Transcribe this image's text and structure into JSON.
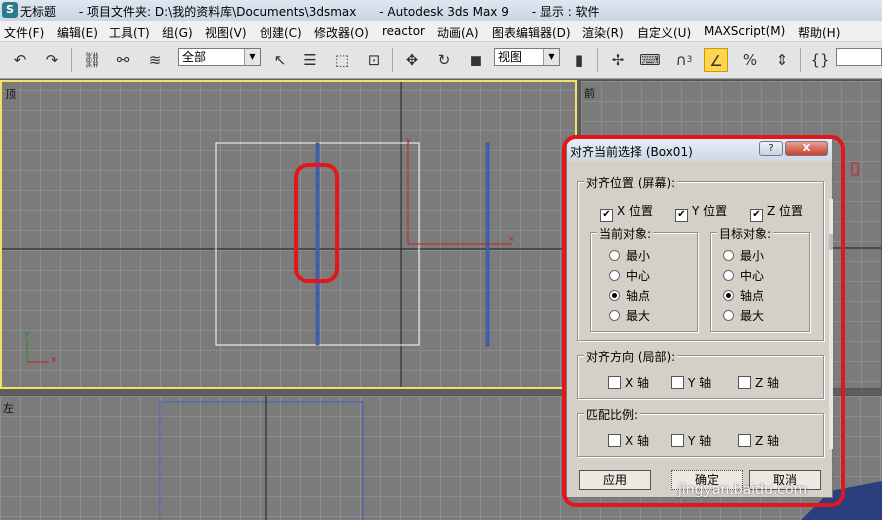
{
  "window": {
    "app_icon": "S",
    "title": "无标题      - 项目文件夹: D:\\我的资料库\\Documents\\3dsmax      - Autodesk 3ds Max 9      - 显示 : 软件"
  },
  "menu": {
    "items": [
      "文件(F)",
      "编辑(E)",
      "工具(T)",
      "组(G)",
      "视图(V)",
      "创建(C)",
      "修改器(O)",
      "reactor",
      "动画(A)",
      "图表编辑器(D)",
      "渲染(R)",
      "自定义(U)",
      "MAXScript(M)",
      "帮助(H)"
    ]
  },
  "toolbar": {
    "selection_filter": "全部",
    "reference_coord": "视图",
    "snap_superscript": "3",
    "icons": [
      "undo-icon",
      "redo-icon",
      "select-link-icon",
      "unlink-icon",
      "bind-spacewarp-icon",
      "select-object-icon",
      "select-by-name-icon",
      "rect-selection-icon",
      "window-crossing-icon",
      "move-icon",
      "rotate-icon",
      "scale-icon",
      "pivot-center-icon",
      "select-manipulate-icon",
      "keyboard-shortcut-icon",
      "snap-toggle-icon",
      "angle-snap-icon",
      "percent-snap-icon",
      "spinner-snap-icon",
      "named-selection-icon",
      "mirror-icon"
    ]
  },
  "viewports": {
    "top": "顶",
    "front": "前",
    "left": "左"
  },
  "axis": {
    "x": "x",
    "y": "y"
  },
  "dialog": {
    "title": "对齐当前选择 (Box01)",
    "help_button": "?",
    "close_button": "X",
    "align_position": {
      "label": "对齐位置 (屏幕):",
      "x": "X 位置",
      "y": "Y 位置",
      "z": "Z 位置",
      "checked": [
        true,
        true,
        true
      ]
    },
    "current_object": {
      "label": "当前对象:",
      "options": [
        "最小",
        "中心",
        "轴点",
        "最大"
      ],
      "selected": 2
    },
    "target_object": {
      "label": "目标对象:",
      "options": [
        "最小",
        "中心",
        "轴点",
        "最大"
      ],
      "selected": 2
    },
    "align_orientation": {
      "label": "对齐方向 (局部):",
      "x": "X 轴",
      "y": "Y 轴",
      "z": "Z 轴"
    },
    "match_scale": {
      "label": "匹配比例:",
      "x": "X 轴",
      "y": "Y 轴",
      "z": "Z 轴"
    },
    "buttons": {
      "apply": "应用",
      "ok": "确定",
      "cancel": "取消"
    }
  },
  "watermark": "jingyan.baidu.com",
  "colors": {
    "active_viewport_border": "#f3e06b",
    "highlight_red": "#e3161c",
    "selected_object_blue": "#3d63b8",
    "active_tool": "#ffd44f"
  }
}
